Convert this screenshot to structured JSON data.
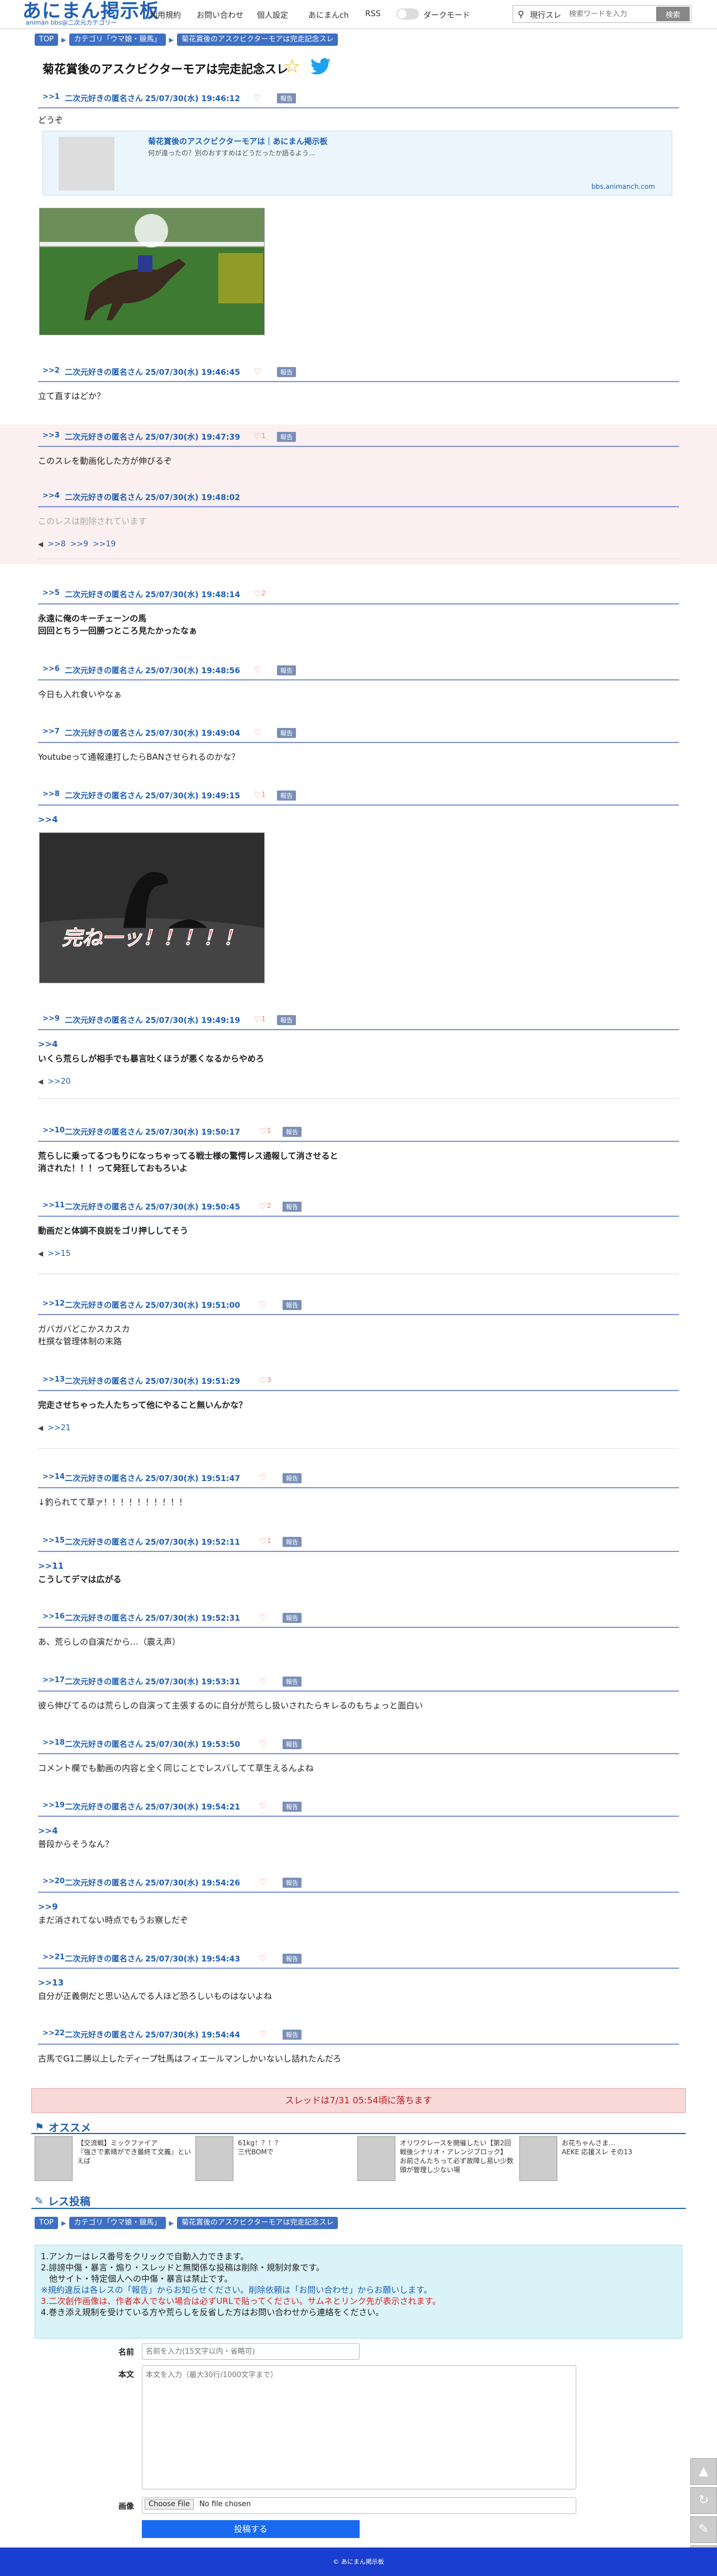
{
  "header": {
    "logo": "あにまん掲示板",
    "logo_sub": "animan bbs@二次元カテゴリー",
    "nav": [
      "利用規約",
      "お問い合わせ",
      "個人設定",
      "あにまんch",
      "RSS",
      "ダークモード"
    ],
    "search_label": "現行スレ",
    "search_placeholder": "検索ワードを入力",
    "search_button": "検索"
  },
  "breadcrumb": [
    "TOP",
    "カテゴリ「ウマ娘・競馬」",
    "菊花賞後のアスクビクターモアは完走記念スレ"
  ],
  "thread_title": "菊花賞後のアスクビクターモアは完走記念スレ",
  "link_card": {
    "title": "菊花賞後のアスクビクターモアは｜あにまん掲示板",
    "desc": "何が違ったの？別のおすすめはどうだったか語るよう...",
    "domain": "bbs.animanch.com"
  },
  "posts": [
    {
      "num": "1",
      "name": "二次元好きの匿名さん",
      "date": "25/07/30(水) 19:46:12",
      "likes": "",
      "body": "どうぞ"
    },
    {
      "num": "2",
      "name": "二次元好きの匿名さん",
      "date": "25/07/30(水) 19:46:45",
      "likes": "",
      "body": "立て直すはどか？"
    },
    {
      "num": "3",
      "name": "二次元好きの匿名さん",
      "date": "25/07/30(水) 19:47:39",
      "likes": "1",
      "body": "このスレを動画化した方が伸びるぞ"
    },
    {
      "num": "4",
      "name": "二次元好きの匿名さん",
      "date": "25/07/30(水) 19:48:02",
      "likes": "",
      "body": "このレスは削除されています",
      "replies": [
        ">>8",
        ">>9",
        ">>19"
      ]
    },
    {
      "num": "5",
      "name": "二次元好きの匿名さん",
      "date": "25/07/30(水) 19:48:14",
      "likes": "2",
      "body": "永遠に俺のキーチェーンの馬\n回回とちう一回勝つところ見たかったなぁ"
    },
    {
      "num": "6",
      "name": "二次元好きの匿名さん",
      "date": "25/07/30(水) 19:48:56",
      "likes": "",
      "body": "今日も入れ食いやなぁ"
    },
    {
      "num": "7",
      "name": "二次元好きの匿名さん",
      "date": "25/07/30(水) 19:49:04",
      "likes": "",
      "body": "Youtubeって通報連打したらBANさせられるのかな？"
    },
    {
      "num": "8",
      "name": "二次元好きの匿名さん",
      "date": "25/07/30(水) 19:49:15",
      "likes": "1",
      "anchor": ">>4",
      "body": "",
      "image_caption": "完ね一ッ！！！！！"
    },
    {
      "num": "9",
      "name": "二次元好きの匿名さん",
      "date": "25/07/30(水) 19:49:19",
      "likes": "1",
      "anchor": ">>4",
      "body": "いくら荒らしが相手でも暴言吐くほうが悪くなるからやめろ",
      "replies": [
        ">>20"
      ]
    },
    {
      "num": "10",
      "name": "二次元好きの匿名さん",
      "date": "25/07/30(水) 19:50:17",
      "likes": "1",
      "body": "荒らしに乗ってるつもりになっちゃってる戦士様の驚愕レス通報して消させると\n消された！！！って発狂しておもろいよ"
    },
    {
      "num": "11",
      "name": "二次元好きの匿名さん",
      "date": "25/07/30(水) 19:50:45",
      "likes": "2",
      "body": "動画だと体調不良説をゴリ押ししてそう",
      "replies": [
        ">>15"
      ]
    },
    {
      "num": "12",
      "name": "二次元好きの匿名さん",
      "date": "25/07/30(水) 19:51:00",
      "likes": "",
      "body": "ガバガバどこかスカスカ\n杜撰な管理体制の末路"
    },
    {
      "num": "13",
      "name": "二次元好きの匿名さん",
      "date": "25/07/30(水) 19:51:29",
      "likes": "3",
      "body": "完走させちゃった人たちって他にやること無いんかな？",
      "replies": [
        ">>21"
      ]
    },
    {
      "num": "14",
      "name": "二次元好きの匿名さん",
      "date": "25/07/30(水) 19:51:47",
      "likes": "",
      "body": "↓釣られてて草ァ！！！！！！！！！！"
    },
    {
      "num": "15",
      "name": "二次元好きの匿名さん",
      "date": "25/07/30(水) 19:52:11",
      "likes": "1",
      "anchor": ">>11",
      "body": "こうしてデマは広がる"
    },
    {
      "num": "16",
      "name": "二次元好きの匿名さん",
      "date": "25/07/30(水) 19:52:31",
      "likes": "",
      "body": "あ、荒らしの自演だから…（震え声）"
    },
    {
      "num": "17",
      "name": "二次元好きの匿名さん",
      "date": "25/07/30(水) 19:53:31",
      "likes": "",
      "body": "彼ら伸びてるのは荒らしの自演って主張するのに自分が荒らし扱いされたらキレるのもちょっと面白い"
    },
    {
      "num": "18",
      "name": "二次元好きの匿名さん",
      "date": "25/07/30(水) 19:53:50",
      "likes": "",
      "body": "コメント欄でも動画の内容と全く同じことでレスバしてて草生えるんよね"
    },
    {
      "num": "19",
      "name": "二次元好きの匿名さん",
      "date": "25/07/30(水) 19:54:21",
      "likes": "",
      "anchor": ">>4",
      "body": "普段からそうなん？"
    },
    {
      "num": "20",
      "name": "二次元好きの匿名さん",
      "date": "25/07/30(水) 19:54:26",
      "likes": "",
      "anchor": ">>9",
      "body": "まだ消されてない時点でもうお察しだぞ"
    },
    {
      "num": "21",
      "name": "二次元好きの匿名さん",
      "date": "25/07/30(水) 19:54:43",
      "likes": "",
      "anchor": ">>13",
      "body": "自分が正義側だと思い込んでる人ほど恐ろしいものはないよね"
    },
    {
      "num": "22",
      "name": "二次元好きの匿名さん",
      "date": "25/07/30(水) 19:54:44",
      "likes": "",
      "body": "古馬でG1二勝以上したディープ牡馬はフィエールマンしかいないし詰れたんだろ"
    }
  ],
  "report_label": "報告",
  "banner": "スレッドは7/31 05:54頃に落ちます",
  "recommend": {
    "heading": "オススメ",
    "items": [
      "【交流戦】ミックファイア",
      "61kg！？！？",
      "オリワクレースを開催したい【第2回戦後シナリオ・アレンジブロック】",
      "お花ちゃんさま…"
    ],
    "items_sub": [
      "『強さで素晴ができ最終て文義』といえば",
      "三代BOMで",
      "お前さんたちって必ず故障し易い少数頭が管理し少ない場",
      "AEKE 応援スレ その13"
    ]
  },
  "reply_form": {
    "heading": "レス投稿",
    "rules": [
      "1.アンカーはレス番号をクリックで自動入力できます。",
      "2.誹謗中傷・暴言・煽り・スレッドと無関係な投稿は削除・規制対象です。",
      "　他サイト・特定個人への中傷・暴言は禁止です。",
      "※規約違反は各レスの「報告」からお知らせください。削除依頼は「お問い合わせ」からお願いします。",
      "3.二次創作画像は、作者本人でない場合は必ずURLで貼ってください。サムネとリンク先が表示されます。",
      "4.巻き添え規制を受けている方や荒らしを反省した方はお問い合わせから連絡をください。"
    ],
    "name_label": "名前",
    "name_placeholder": "名前を入力(15文字以内・省略可)",
    "body_label": "本文",
    "body_placeholder": "本文を入力（最大30行/1000文字まで）",
    "image_label": "画像",
    "file_button": "Choose File",
    "file_status": "No file chosen",
    "submit": "投稿する"
  },
  "footer": "© あにまん掲示板"
}
